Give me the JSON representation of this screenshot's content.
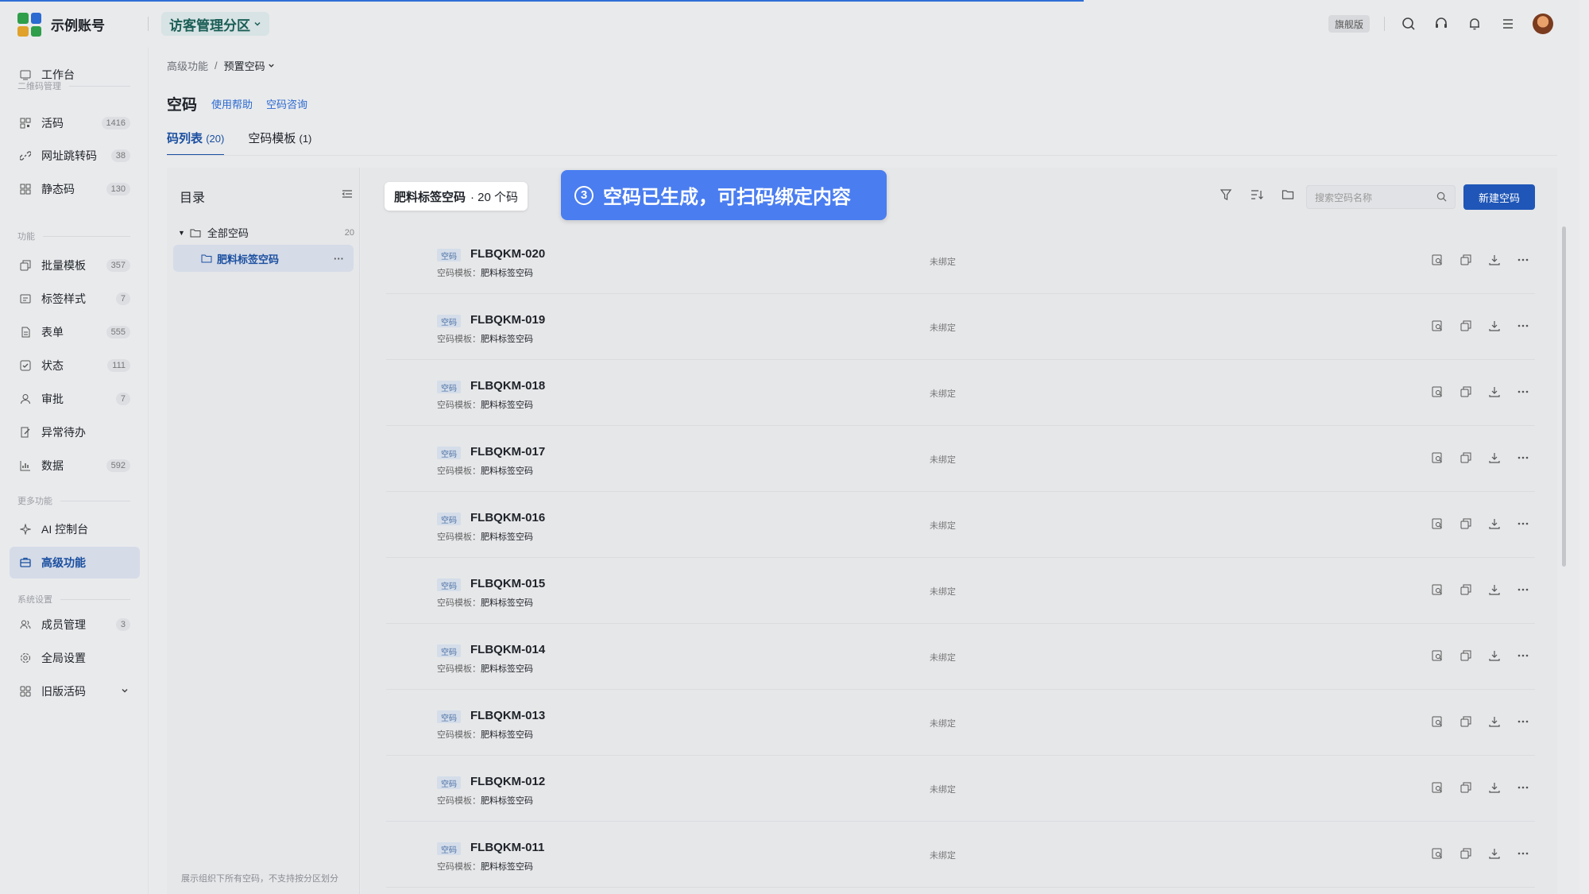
{
  "topbar": {
    "account_name": "示例账号",
    "partition": "访客管理分区",
    "edition": "旗舰版",
    "icons": [
      "search-icon",
      "headset-icon",
      "bell-icon",
      "menu-icon"
    ]
  },
  "sidebar": {
    "items": [
      {
        "label": "工作台",
        "icon": "workbench-icon",
        "count": ""
      },
      {
        "label": "活码",
        "icon": "qrcode-icon",
        "count": "1416"
      },
      {
        "label": "网址跳转码",
        "icon": "link-icon",
        "count": "38"
      },
      {
        "label": "静态码",
        "icon": "static-code-icon",
        "count": "130"
      },
      {
        "label": "批量模板",
        "icon": "batch-template-icon",
        "count": "357"
      },
      {
        "label": "标签样式",
        "icon": "label-style-icon",
        "count": "7"
      },
      {
        "label": "表单",
        "icon": "form-icon",
        "count": "555"
      },
      {
        "label": "状态",
        "icon": "status-icon",
        "count": "111"
      },
      {
        "label": "审批",
        "icon": "approval-icon",
        "count": "7"
      },
      {
        "label": "异常待办",
        "icon": "exception-icon",
        "count": ""
      },
      {
        "label": "数据",
        "icon": "data-chart-icon",
        "count": "592"
      },
      {
        "label": "AI 控制台",
        "icon": "ai-icon",
        "count": ""
      },
      {
        "label": "高级功能",
        "icon": "advanced-icon",
        "count": ""
      },
      {
        "label": "成员管理",
        "icon": "members-icon",
        "count": "3"
      },
      {
        "label": "全局设置",
        "icon": "settings-icon",
        "count": ""
      },
      {
        "label": "旧版活码",
        "icon": "legacy-icon",
        "count": ""
      }
    ],
    "sections": [
      "二维码管理",
      "功能",
      "更多功能",
      "系统设置"
    ]
  },
  "breadcrumb": {
    "parent": "高级功能",
    "separator": "/",
    "current": "预置空码"
  },
  "page": {
    "title": "空码",
    "help_link": "使用帮助",
    "consult_link": "空码咨询"
  },
  "tabs": [
    {
      "label": "码列表",
      "count": "(20)"
    },
    {
      "label": "空码模板",
      "count": "(1)"
    }
  ],
  "directory": {
    "title": "目录",
    "root_label": "全部空码",
    "root_count": "20",
    "child_label": "肥料标签空码",
    "footer": "展示组织下所有空码，不支持按分区划分"
  },
  "list": {
    "group_name": "肥料标签空码",
    "group_count": "· 20 个码",
    "toast_num": "3",
    "toast_text": "空码已生成，可扫码绑定内容",
    "search_placeholder": "搜索空码名称",
    "new_button": "新建空码",
    "tag": "空码",
    "template_label": "空码模板：",
    "rows": [
      {
        "code": "FLBQKM-020",
        "template": "肥料标签空码",
        "status": "未绑定"
      },
      {
        "code": "FLBQKM-019",
        "template": "肥料标签空码",
        "status": "未绑定"
      },
      {
        "code": "FLBQKM-018",
        "template": "肥料标签空码",
        "status": "未绑定"
      },
      {
        "code": "FLBQKM-017",
        "template": "肥料标签空码",
        "status": "未绑定"
      },
      {
        "code": "FLBQKM-016",
        "template": "肥料标签空码",
        "status": "未绑定"
      },
      {
        "code": "FLBQKM-015",
        "template": "肥料标签空码",
        "status": "未绑定"
      },
      {
        "code": "FLBQKM-014",
        "template": "肥料标签空码",
        "status": "未绑定"
      },
      {
        "code": "FLBQKM-013",
        "template": "肥料标签空码",
        "status": "未绑定"
      },
      {
        "code": "FLBQKM-012",
        "template": "肥料标签空码",
        "status": "未绑定"
      },
      {
        "code": "FLBQKM-011",
        "template": "肥料标签空码",
        "status": "未绑定"
      }
    ]
  },
  "colors": {
    "accent": "#1f56b7",
    "toast": "#4a7df0",
    "brand_green": "#1b5e56"
  }
}
